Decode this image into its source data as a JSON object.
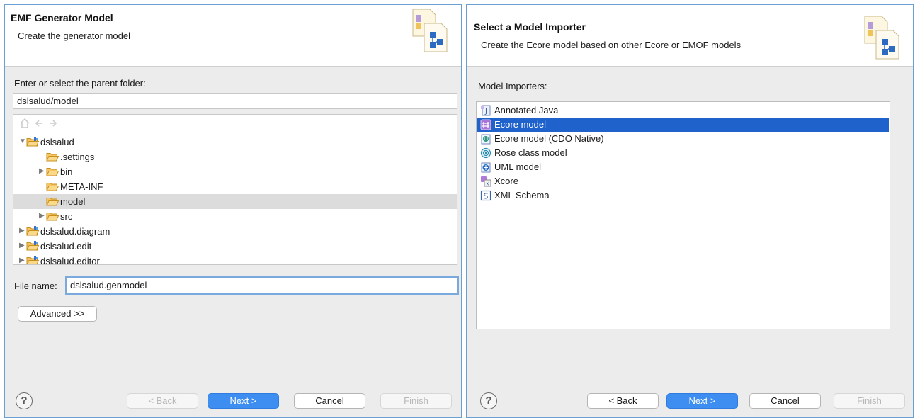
{
  "left_wizard": {
    "title": "EMF Generator Model",
    "description": "Create the generator model",
    "parent_folder_label": "Enter or select the parent folder:",
    "parent_folder_value": "dslsalud/model",
    "tree": [
      {
        "label": "dslsalud"
      },
      {
        "label": ".settings"
      },
      {
        "label": "bin"
      },
      {
        "label": "META-INF"
      },
      {
        "label": "model"
      },
      {
        "label": "src"
      },
      {
        "label": "dslsalud.diagram"
      },
      {
        "label": "dslsalud.edit"
      },
      {
        "label": "dslsalud.editor"
      }
    ],
    "file_name_label": "File name:",
    "file_name_value": "dslsalud.genmodel",
    "advanced_button": "Advanced >>",
    "help_symbol": "?",
    "buttons": {
      "back": "< Back",
      "next": "Next >",
      "cancel": "Cancel",
      "finish": "Finish"
    }
  },
  "right_wizard": {
    "title": "Select a Model Importer",
    "description": "Create the Ecore model based on other Ecore or EMOF models",
    "importers_label": "Model Importers:",
    "importers": [
      {
        "label": "Annotated Java",
        "icon": "java-icon"
      },
      {
        "label": "Ecore model",
        "icon": "ecore-icon"
      },
      {
        "label": "Ecore model (CDO Native)",
        "icon": "cdo-icon"
      },
      {
        "label": "Rose class model",
        "icon": "rose-icon"
      },
      {
        "label": "UML model",
        "icon": "uml-icon"
      },
      {
        "label": "Xcore",
        "icon": "xcore-icon"
      },
      {
        "label": "XML Schema",
        "icon": "xml-schema-icon"
      }
    ],
    "selected_importer": "Ecore model",
    "help_symbol": "?",
    "buttons": {
      "back": "< Back",
      "next": "Next >",
      "cancel": "Cancel",
      "finish": "Finish"
    }
  },
  "colors": {
    "selection_blue": "#1f62cc",
    "primary_button": "#3d8ef0",
    "focus_ring": "#7aa9de"
  }
}
